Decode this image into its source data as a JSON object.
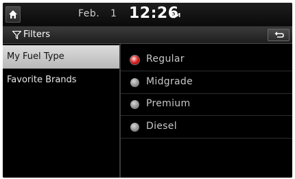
{
  "status": {
    "date": "Feb.",
    "day": "1",
    "time": "12:26",
    "ampm": "AM"
  },
  "header": {
    "title": "Filters",
    "icons": {
      "home": "home-icon",
      "filter": "filter-icon",
      "back": "back-arrow-icon"
    }
  },
  "menu": {
    "items": [
      {
        "label": "My Fuel Type",
        "selected": true
      },
      {
        "label": "Favorite Brands",
        "selected": false
      }
    ]
  },
  "fuel_options": {
    "selected": "Regular",
    "items": [
      {
        "label": "Regular",
        "selected": true
      },
      {
        "label": "Midgrade",
        "selected": false
      },
      {
        "label": "Premium",
        "selected": false
      },
      {
        "label": "Diesel",
        "selected": false
      }
    ]
  },
  "colors": {
    "selected_radio": "#d21c1c",
    "unselected_radio": "#9a9a9a",
    "selected_row": "#c8c8c8"
  }
}
